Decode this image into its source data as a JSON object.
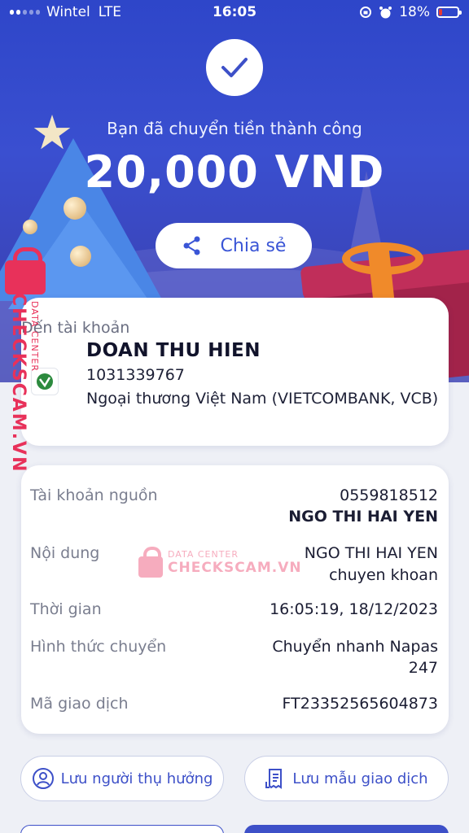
{
  "status_bar": {
    "carrier": "Wintel",
    "network": "LTE",
    "time": "16:05",
    "battery_percent": "18%",
    "battery_level": 0.18,
    "signal_bars_active": 2,
    "signal_bars_total": 5
  },
  "hero": {
    "success_message": "Bạn đã chuyển tiền thành công",
    "amount": "20,000 VND",
    "share_label": "Chia sẻ"
  },
  "recipient": {
    "label": "Đến tài khoản",
    "name": "DOAN THU HIEN",
    "account_number": "1031339767",
    "bank": "Ngoại thương Việt Nam (VIETCOMBANK, VCB)"
  },
  "details": {
    "rows": [
      {
        "label": "Tài khoản nguồn",
        "value": "0559818512",
        "value2": "NGO THI HAI YEN"
      },
      {
        "label": "Nội dung",
        "value": "NGO THI HAI YEN",
        "value2": "chuyen khoan"
      },
      {
        "label": "Thời gian",
        "value": "16:05:19, 18/12/2023"
      },
      {
        "label": "Hình thức chuyển",
        "value": "Chuyển nhanh Napas",
        "value2": "247"
      },
      {
        "label": "Mã giao dịch",
        "value": "FT23352565604873"
      }
    ]
  },
  "actions": {
    "save_beneficiary": "Lưu người thụ hưởng",
    "save_template": "Lưu mẫu giao dịch"
  },
  "watermark": {
    "brand": "CHECKSCAM.VN",
    "sub": "DATA CENTER"
  },
  "colors": {
    "brand_blue": "#3d50c8",
    "watermark_pink": "#e8315a"
  }
}
